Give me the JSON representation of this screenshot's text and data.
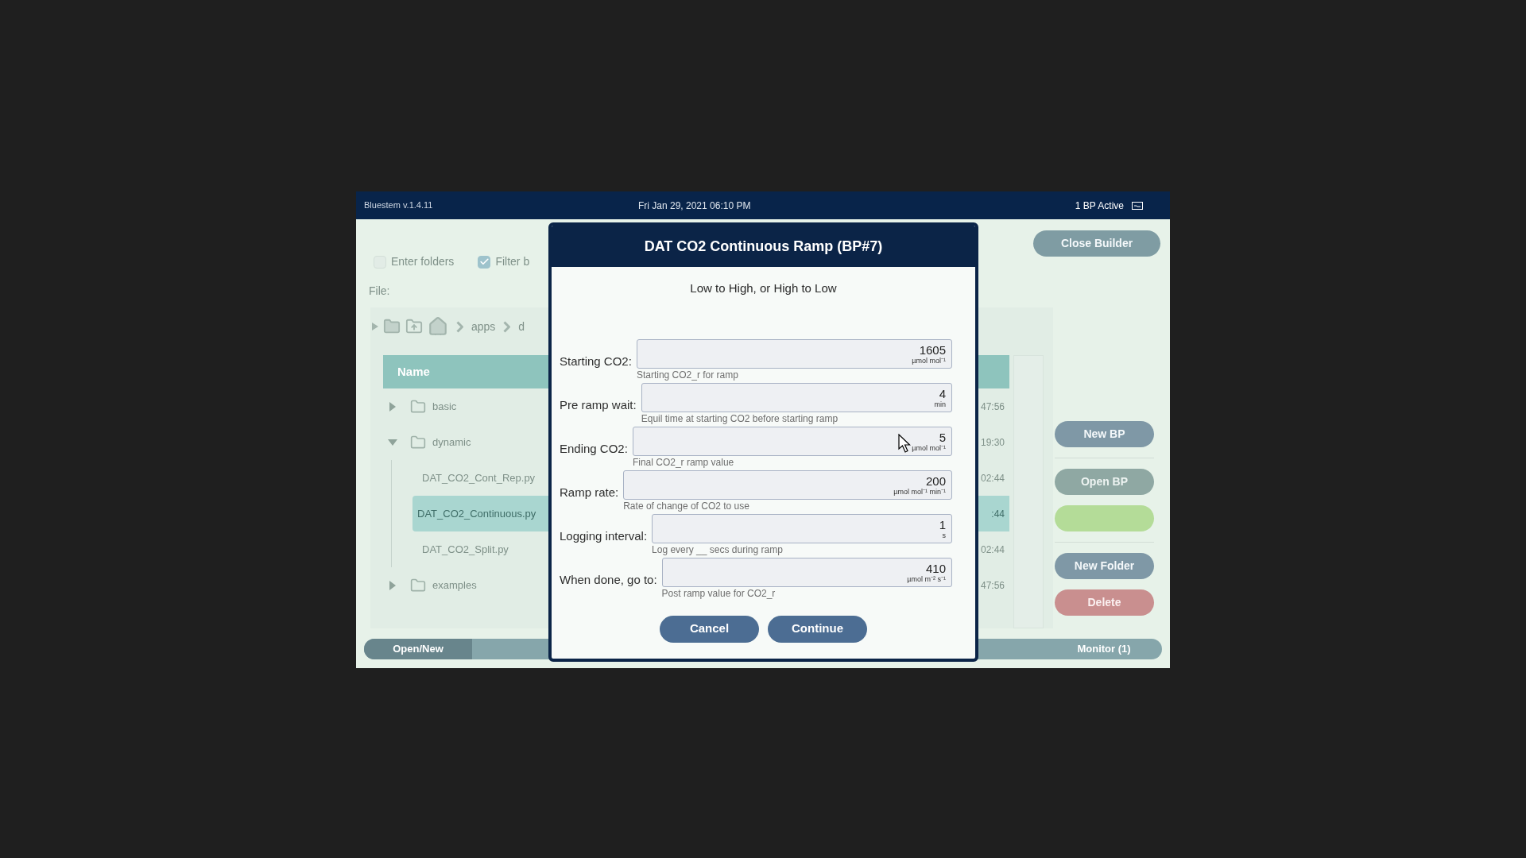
{
  "title_bar": {
    "app_version": "Bluestem v.1.4.11",
    "datetime": "Fri Jan 29, 2021 06:10 PM",
    "status": "1 BP Active"
  },
  "background": {
    "options": [
      {
        "label": "Enter folders",
        "checked": false
      },
      {
        "label": "Filter b",
        "checked": true
      }
    ],
    "close_button": "Close Builder",
    "file_label": "File:",
    "breadcrumb": [
      "apps",
      "d"
    ],
    "table": {
      "columns": [
        "Name"
      ],
      "rows": [
        {
          "name": "basic",
          "kind": "folder",
          "expanded": false,
          "selected": false,
          "time": "47:56"
        },
        {
          "name": "dynamic",
          "kind": "folder",
          "expanded": true,
          "selected": false,
          "time": "19:30",
          "children": [
            {
              "name": "DAT_CO2_Cont_Rep.py",
              "kind": "file",
              "selected": false,
              "time": "02:44"
            },
            {
              "name": "DAT_CO2_Continuous.py",
              "kind": "file",
              "selected": true,
              "time": ":44"
            },
            {
              "name": "DAT_CO2_Split.py",
              "kind": "file",
              "selected": false,
              "time": "02:44"
            }
          ]
        },
        {
          "name": "examples",
          "kind": "folder",
          "expanded": false,
          "selected": false,
          "time": "47:56"
        }
      ]
    },
    "buttons": [
      {
        "label": "New BP",
        "kind": "primary"
      },
      {
        "label": "Open BP",
        "kind": "disabled"
      },
      {
        "kind": "success"
      },
      {
        "label": "New Folder",
        "kind": "primary"
      },
      {
        "label": "Delete",
        "kind": "danger"
      }
    ],
    "bottom_tabs": [
      {
        "label": "Open/New",
        "selected": true
      },
      {
        "label": "Monitor (1)",
        "selected": false
      }
    ]
  },
  "dialog": {
    "title": "DAT CO2 Continuous Ramp (BP#7)",
    "subtitle": "Low to High, or High to Low",
    "fields": [
      {
        "label": "Starting CO2:",
        "value": "1605",
        "unit": "µmol mol⁻¹",
        "hint": "Starting CO2_r for ramp"
      },
      {
        "label": "Pre ramp wait:",
        "value": "4",
        "unit": "min",
        "hint": "Equil time at starting CO2 before starting ramp"
      },
      {
        "label": "Ending CO2:",
        "value": "5",
        "unit": "µmol mol⁻¹",
        "hint": "Final CO2_r ramp value"
      },
      {
        "label": "Ramp rate:",
        "value": "200",
        "unit": "µmol mol⁻¹ min⁻¹",
        "hint": "Rate of change of CO2 to use"
      },
      {
        "label": "Logging interval:",
        "value": "1",
        "unit": "s",
        "hint": "Log every __ secs during ramp"
      },
      {
        "label": "When done, go to:",
        "value": "410",
        "unit": "µmol m⁻² s⁻¹",
        "hint": "Post ramp value for CO2_r"
      }
    ],
    "buttons": [
      "Cancel",
      "Continue"
    ]
  }
}
